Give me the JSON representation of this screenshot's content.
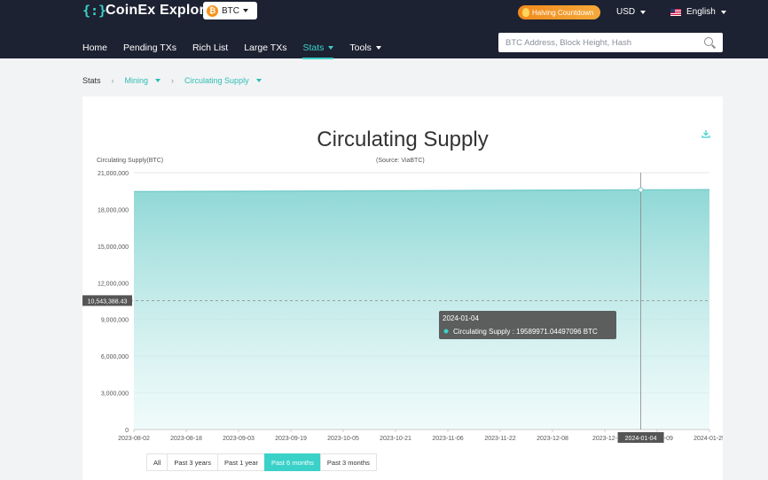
{
  "header": {
    "brand": "CoinEx Explorer",
    "coin": "BTC",
    "halving": "Halving Countdown",
    "currency": "USD",
    "language": "English",
    "nav": [
      {
        "label": "Home"
      },
      {
        "label": "Pending TXs"
      },
      {
        "label": "Rich List"
      },
      {
        "label": "Large TXs"
      },
      {
        "label": "Stats"
      },
      {
        "label": "Tools"
      }
    ],
    "search_placeholder": "BTC Address, Block Height, Hash"
  },
  "breadcrumb": {
    "root": "Stats",
    "level1": "Mining",
    "level2": "Circulating Supply"
  },
  "chart_data": {
    "type": "area",
    "title": "Circulating Supply",
    "ylabel": "Circulating Supply(BTC)",
    "source": "(Source: ViaBTC)",
    "ylim": [
      0,
      21000000
    ],
    "yticks": [
      "21,000,000",
      "18,000,000",
      "15,000,000",
      "12,000,000",
      "9,000,000",
      "6,000,000",
      "3,000,000",
      "0"
    ],
    "ytick_values": [
      21000000,
      18000000,
      15000000,
      12000000,
      9000000,
      6000000,
      3000000,
      0
    ],
    "xticks": [
      "2023-08-02",
      "2023-08-18",
      "2023-09-03",
      "2023-09-19",
      "2023-10-05",
      "2023-10-21",
      "2023-11-06",
      "2023-11-22",
      "2023-12-08",
      "2023-12-",
      "2024-01-09",
      "2024-01-25"
    ],
    "x": [
      "2023-08-02",
      "2024-01-25"
    ],
    "y": [
      19450000,
      19620000
    ],
    "series": [
      {
        "name": "Circulating Supply",
        "values": [
          19450000,
          19620000
        ]
      }
    ],
    "area_color": "#8fd8d6",
    "line_color": "#6cc9c6",
    "crosshair": {
      "x_label": "2024-01-04",
      "y_label": "10,543,388.43",
      "y_value": 10543388.43
    },
    "tooltip": {
      "date": "2024-01-04",
      "series": "Circulating Supply",
      "value": "19589971.04497096 BTC"
    }
  },
  "filters": [
    {
      "label": "All"
    },
    {
      "label": "Past 3 years"
    },
    {
      "label": "Past 1 year"
    },
    {
      "label": "Past 6 months",
      "active": true
    },
    {
      "label": "Past 3 months"
    }
  ]
}
